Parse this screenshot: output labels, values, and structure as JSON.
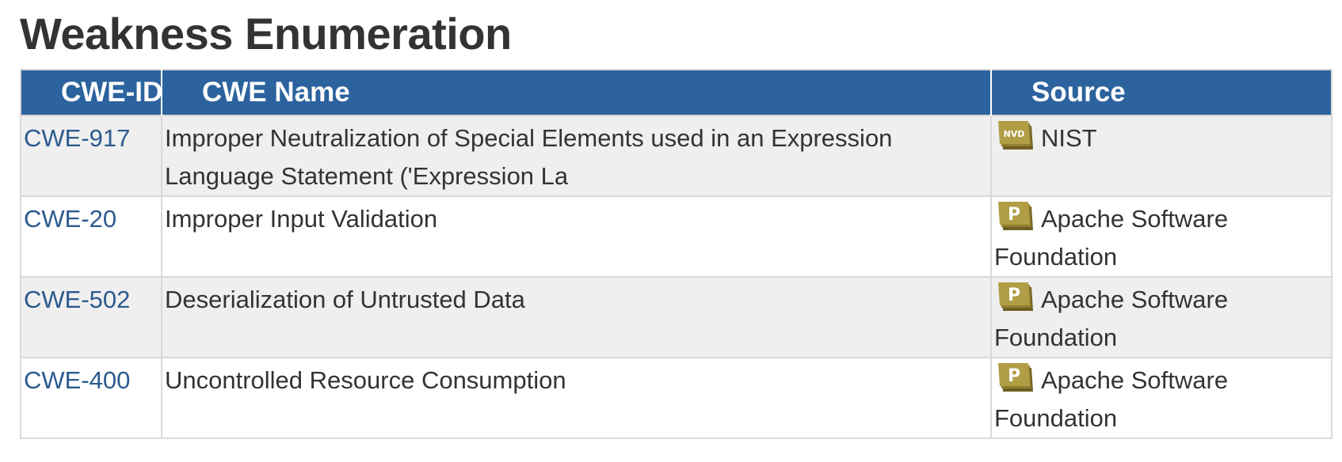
{
  "section": {
    "title": "Weakness Enumeration"
  },
  "table": {
    "headers": {
      "cwe_id": "CWE-ID",
      "cwe_name": "CWE Name",
      "source": "Source"
    },
    "rows": [
      {
        "cwe_id": "CWE-917",
        "cwe_name": "Improper Neutralization of Special Elements used in an Expression Language Statement ('Expression La",
        "source": "NIST",
        "source_icon": "nvd-icon",
        "icon_text": "NVD"
      },
      {
        "cwe_id": "CWE-20",
        "cwe_name": "Improper Input Validation",
        "source": "Apache Software Foundation",
        "source_icon": "cna-p-icon",
        "icon_text": "P"
      },
      {
        "cwe_id": "CWE-502",
        "cwe_name": "Deserialization of Untrusted Data",
        "source": "Apache Software Foundation",
        "source_icon": "cna-p-icon",
        "icon_text": "P"
      },
      {
        "cwe_id": "CWE-400",
        "cwe_name": "Uncontrolled Resource Consumption",
        "source": "Apache Software Foundation",
        "source_icon": "cna-p-icon",
        "icon_text": "P"
      }
    ]
  },
  "colors": {
    "header_bg": "#2c639e",
    "link": "#2c5a8f",
    "icon_gold": "#a8943c",
    "icon_dark": "#6e5f22"
  }
}
